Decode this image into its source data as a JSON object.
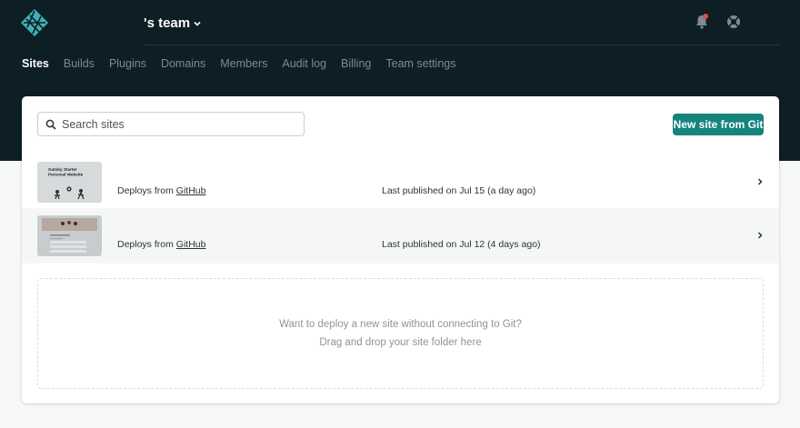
{
  "header": {
    "team_name": "'s team",
    "nav": [
      {
        "label": "Sites",
        "active": true
      },
      {
        "label": "Builds",
        "active": false
      },
      {
        "label": "Plugins",
        "active": false
      },
      {
        "label": "Domains",
        "active": false
      },
      {
        "label": "Members",
        "active": false
      },
      {
        "label": "Audit log",
        "active": false
      },
      {
        "label": "Billing",
        "active": false
      },
      {
        "label": "Team settings",
        "active": false
      }
    ],
    "icons": [
      "netlify-logo-icon",
      "chevron-down-icon",
      "bell-icon",
      "lifebuoy-help-icon"
    ]
  },
  "sites": {
    "search_placeholder": "Search sites",
    "new_site_label": "New site from Git",
    "rows": [
      {
        "thumb_title_1": "Gatsby Starter",
        "thumb_title_2": "Personal Website",
        "deploy_prefix": "Deploys from",
        "deploy_link": "GitHub",
        "published": "Last published on Jul 15 (a day ago)"
      },
      {
        "deploy_prefix": "Deploys from",
        "deploy_link": "GitHub",
        "published": "Last published on Jul 12 (4 days ago)"
      }
    ]
  },
  "dropzone": {
    "line1": "Want to deploy a new site without connecting to Git?",
    "line2": "Drag and drop your site folder here"
  },
  "colors": {
    "topbar": "#0e1e25",
    "accent": "#15847d",
    "notification": "#e5484d"
  }
}
